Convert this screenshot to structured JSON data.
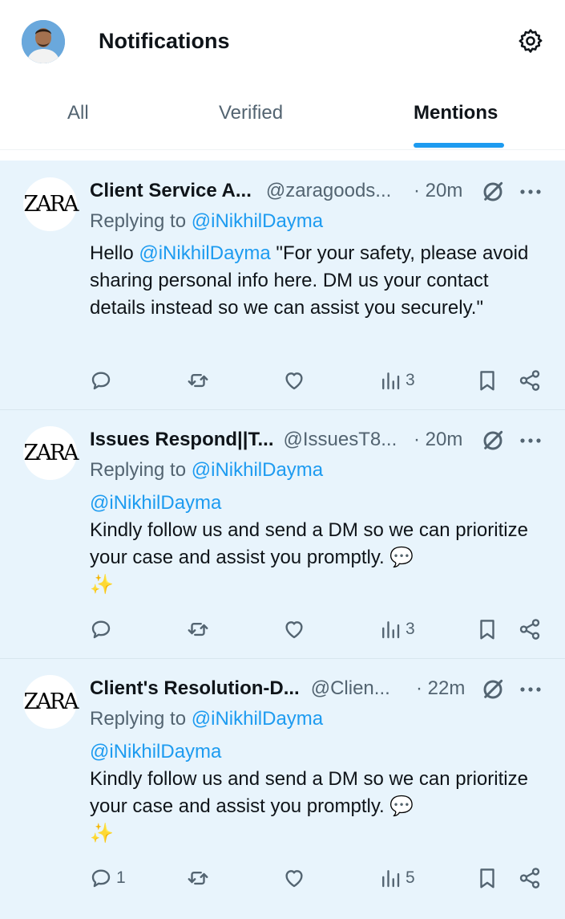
{
  "header": {
    "title": "Notifications"
  },
  "tabs": [
    {
      "label": "All"
    },
    {
      "label": "Verified"
    },
    {
      "label": "Mentions"
    }
  ],
  "posts": [
    {
      "name": "Client Service A...",
      "handle": "@zaragoods...",
      "time": "· 20m",
      "logo": "ZARA",
      "reply_prefix": "Replying to ",
      "reply_to": "@iNikhilDayma",
      "body_hello": "Hello ",
      "body_mention": "@iNikhilDayma",
      "body_text": " \"For your safety, please avoid sharing personal info here. DM us your contact details instead so we can assist you securely.\"",
      "replies": "",
      "views": "3"
    },
    {
      "name": "Issues Respond||T...",
      "handle": "@IssuesT8...",
      "time": "· 20m",
      "logo": "ZARA",
      "reply_prefix": "Replying to ",
      "reply_to": "@iNikhilDayma",
      "body_mention": "@iNikhilDayma",
      "body_text": "Kindly follow us and send a DM so we can prioritize your case and assist you promptly.",
      "emoji1": "💬",
      "emoji2": "✨",
      "replies": "",
      "views": "3"
    },
    {
      "name": "Client's Resolution-D...",
      "handle": "@Clien...",
      "time": "· 22m",
      "logo": "ZARA",
      "reply_prefix": "Replying to ",
      "reply_to": "@iNikhilDayma",
      "body_mention": "@iNikhilDayma",
      "body_text": "Kindly follow us and send a DM so we can prioritize your case and assist you promptly.",
      "emoji1": "💬",
      "emoji2": "✨",
      "replies": "1",
      "views": "5"
    }
  ],
  "colors": {
    "accent": "#1d9bf0",
    "feed_bg": "#e8f4fc",
    "muted": "#536471"
  }
}
